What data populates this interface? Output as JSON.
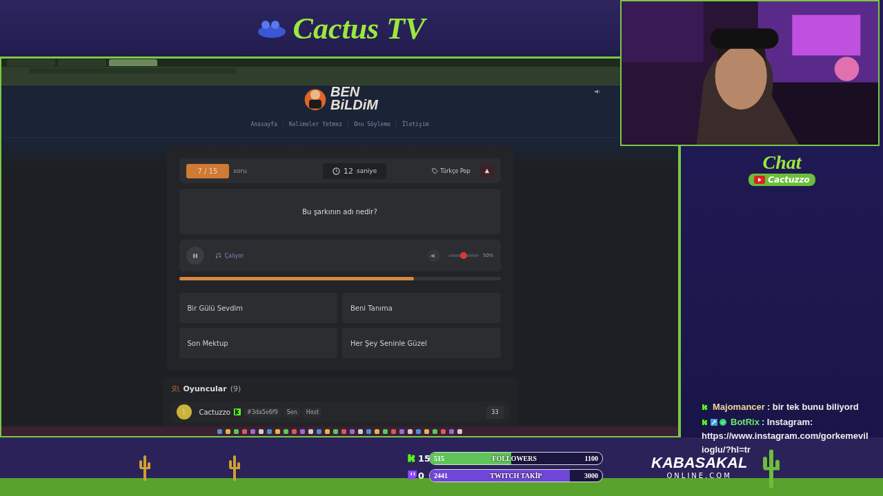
{
  "overlay": {
    "logo": "Cactus TV"
  },
  "browser": {
    "tabs": [
      {
        "selected": false
      },
      {
        "selected": false
      },
      {
        "selected": true
      }
    ]
  },
  "site": {
    "logo_top": "BEN",
    "logo_bottom": "BiLDiM",
    "nav": [
      "Anasayfa",
      "Kelimeler Yetmez",
      "Onu Söyleme",
      "İletişim"
    ],
    "game": {
      "counter": "7 / 15",
      "counter_label": "soru",
      "timer": "12",
      "timer_unit": "saniye",
      "category": "Türkçe Pop",
      "question": "Bu şarkının adı nedir?",
      "player": {
        "status": "Çalıyor",
        "volume": {
          "level": 0.5
        },
        "volume_reading": "50%"
      },
      "progress": {
        "level": 0.73
      },
      "answers": [
        "Bir Gülü Sevdim",
        "Beni Tanıma",
        "Son Mektup",
        "Her Şey Seninle Güzel"
      ]
    },
    "players": {
      "title": "Oyuncular",
      "count": "(9)",
      "rows": [
        {
          "rank": "1",
          "name": "Cactuzzo",
          "id": "#3da5e6f9",
          "you": "Sen",
          "role": "Host",
          "score": "33"
        }
      ]
    }
  },
  "chat": {
    "title": "Chat",
    "channel": "Cactuzzo",
    "messages": [
      {
        "user": "Majomancer",
        "color": "#f2d59a",
        "text": ": bir tek bunu biliyord",
        "badges": [
          {
            "kind": "kick"
          }
        ]
      },
      {
        "user": "BotRix",
        "color": "#6ee86e",
        "text": ": Instagram:",
        "link": "https://www.instagram.com/gorkemevilioglu/?hl=tr",
        "badges": [
          {
            "kind": "kick"
          },
          {
            "kind": "mod"
          },
          {
            "kind": "verified"
          }
        ]
      }
    ]
  },
  "goals": [
    {
      "kind": "kick",
      "count": "15",
      "start": "515",
      "label": "FOLLOWERS",
      "target": "1100",
      "level": 0.47
    },
    {
      "kind": "twitch",
      "count": "0",
      "start": "2441",
      "label": "TWITCH TAKİP",
      "target": "3000",
      "level": 0.81
    }
  ],
  "sponsor": {
    "name": "KABASAKAL",
    "domain": "ONLINE.COM"
  }
}
